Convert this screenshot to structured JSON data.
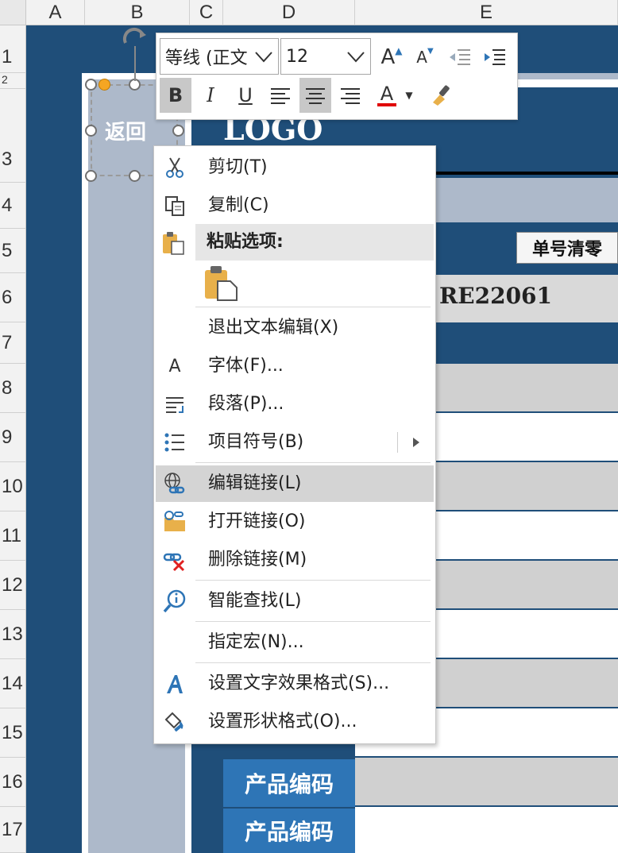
{
  "columns": [
    "A",
    "B",
    "C",
    "D",
    "E"
  ],
  "rows": [
    "1",
    "2",
    "3",
    "4",
    "5",
    "6",
    "7",
    "8",
    "9",
    "10",
    "11",
    "12",
    "13",
    "14",
    "15",
    "16",
    "17"
  ],
  "sheet": {
    "logo": "LOGO",
    "order_clear_button": "单号清零",
    "order_number": "RE22061",
    "product_code_labels": [
      "产品编码",
      "产品编码"
    ]
  },
  "shape": {
    "text": "返回"
  },
  "toolbar": {
    "font_name": "等线 (正文",
    "font_size": "12",
    "grow_font": "A",
    "shrink_font": "A",
    "bold": "B",
    "italic": "I",
    "underline": "U",
    "font_color": "A"
  },
  "context_menu": {
    "cut": "剪切(T)",
    "copy": "复制(C)",
    "paste_options": "粘贴选项:",
    "exit_text_edit": "退出文本编辑(X)",
    "font": "字体(F)...",
    "paragraph": "段落(P)...",
    "bullets": "项目符号(B)",
    "edit_link": "编辑链接(L)",
    "open_link": "打开链接(O)",
    "remove_link": "删除链接(M)",
    "smart_lookup": "智能查找(L)",
    "assign_macro": "指定宏(N)...",
    "format_text_effects": "设置文字效果格式(S)...",
    "format_shape": "设置形状格式(O)...",
    "font_icon_letter": "A"
  },
  "colors": {
    "navy": "#1f4e79",
    "label_blue": "#2e75b6",
    "highlight": "#d4d4d4",
    "font_color_bar": "#e00000"
  }
}
